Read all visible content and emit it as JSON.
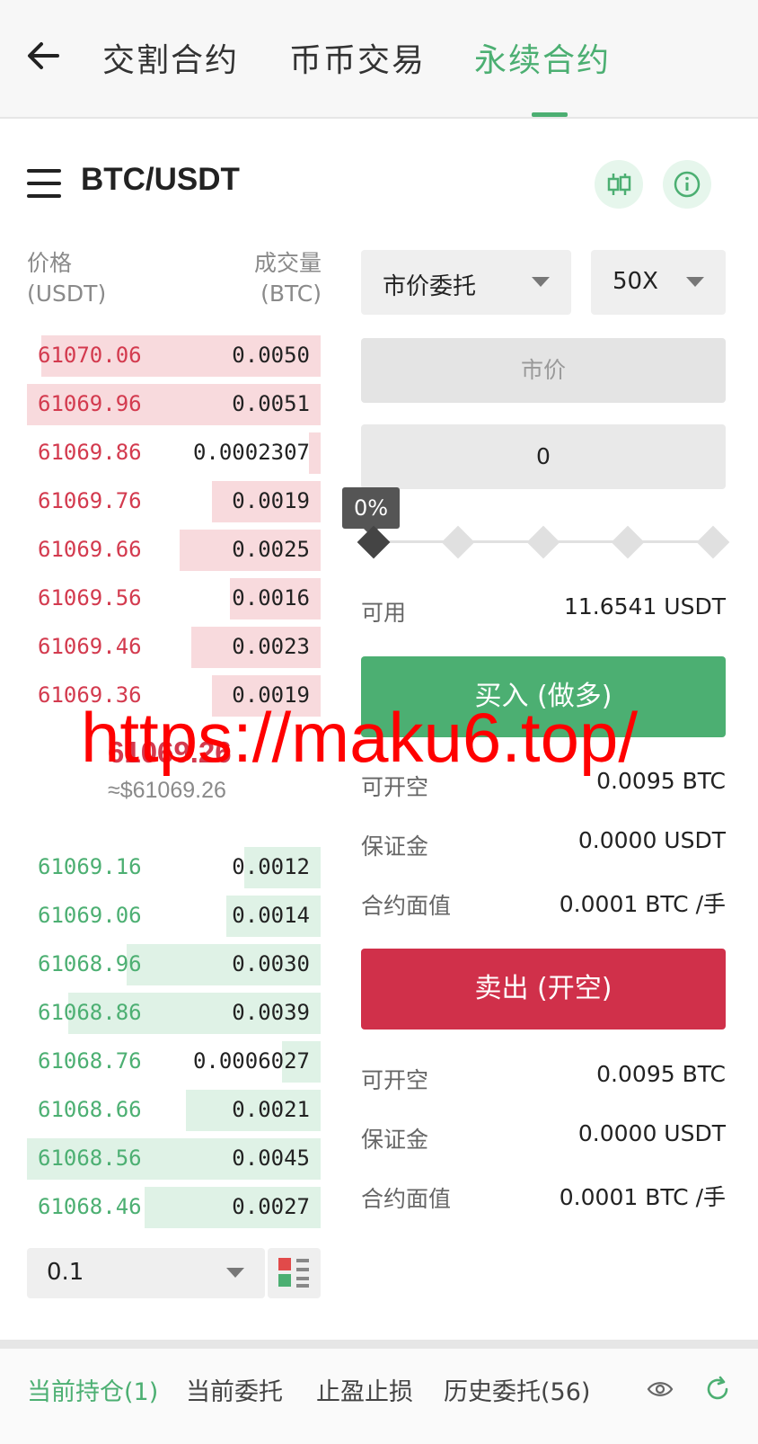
{
  "nav": {
    "tabs": [
      {
        "label": "交割合约"
      },
      {
        "label": "币币交易"
      },
      {
        "label": "永续合约"
      }
    ]
  },
  "pair": "BTC/USDT",
  "orderbook": {
    "price_label": "价格",
    "price_unit": "(USDT)",
    "qty_label": "成交量",
    "qty_unit": "(BTC)",
    "asks": [
      {
        "price": "61070.06",
        "qty": "0.0050",
        "depth": 0.95
      },
      {
        "price": "61069.96",
        "qty": "0.0051",
        "depth": 1.0
      },
      {
        "price": "61069.86",
        "qty": "0.0002307",
        "depth": 0.04
      },
      {
        "price": "61069.76",
        "qty": "0.0019",
        "depth": 0.37
      },
      {
        "price": "61069.66",
        "qty": "0.0025",
        "depth": 0.48
      },
      {
        "price": "61069.56",
        "qty": "0.0016",
        "depth": 0.31
      },
      {
        "price": "61069.46",
        "qty": "0.0023",
        "depth": 0.44
      },
      {
        "price": "61069.36",
        "qty": "0.0019",
        "depth": 0.37
      }
    ],
    "mid_price": "61069.26",
    "mid_usd": "≈$61069.26",
    "bids": [
      {
        "price": "61069.16",
        "qty": "0.0012",
        "depth": 0.26
      },
      {
        "price": "61069.06",
        "qty": "0.0014",
        "depth": 0.32
      },
      {
        "price": "61068.96",
        "qty": "0.0030",
        "depth": 0.66
      },
      {
        "price": "61068.86",
        "qty": "0.0039",
        "depth": 0.86
      },
      {
        "price": "61068.76",
        "qty": "0.0006027",
        "depth": 0.13
      },
      {
        "price": "61068.66",
        "qty": "0.0021",
        "depth": 0.46
      },
      {
        "price": "61068.56",
        "qty": "0.0045",
        "depth": 1.0
      },
      {
        "price": "61068.46",
        "qty": "0.0027",
        "depth": 0.6
      }
    ],
    "depth_value": "0.1"
  },
  "order": {
    "type": "市价委托",
    "leverage": "50X",
    "price_placeholder": "市价",
    "amount": "0",
    "percent": "0%",
    "available_label": "可用",
    "available_value": "11.6541 USDT",
    "buy_label": "买入 (做多)",
    "sell_label": "卖出 (开空)",
    "buy_info": [
      {
        "label": "可开空",
        "value": "0.0095 BTC"
      },
      {
        "label": "保证金",
        "value": "0.0000 USDT"
      },
      {
        "label": "合约面值",
        "value": "0.0001 BTC /手"
      }
    ],
    "sell_info": [
      {
        "label": "可开空",
        "value": "0.0095 BTC"
      },
      {
        "label": "保证金",
        "value": "0.0000 USDT"
      },
      {
        "label": "合约面值",
        "value": "0.0001 BTC /手"
      }
    ]
  },
  "bottom_tabs": [
    {
      "label": "当前持仓(1)"
    },
    {
      "label": "当前委托"
    },
    {
      "label": "止盈止损"
    },
    {
      "label": "历史委托(56)"
    }
  ],
  "watermark": "https://maku6.top/",
  "colors": {
    "accent": "#4caf72",
    "sell": "#d0304a"
  }
}
